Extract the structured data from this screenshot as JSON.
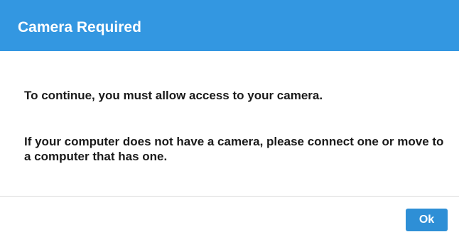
{
  "dialog": {
    "title": "Camera Required",
    "messages": [
      "To continue, you must allow access to your camera.",
      "If your computer does not have a camera, please connect one or move to a computer that has one."
    ],
    "ok_label": "Ok"
  },
  "colors": {
    "header_background": "#3397e1",
    "button_background": "#2e8fd6",
    "text": "#1a1a1a"
  }
}
